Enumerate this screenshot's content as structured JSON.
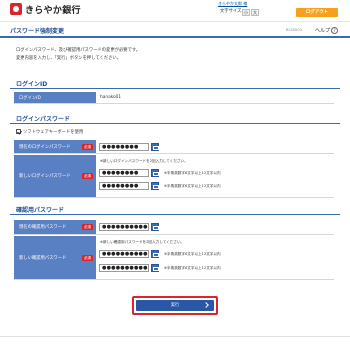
{
  "header": {
    "brand": "きらやか銀行",
    "user_name": "きらやか太郎 様",
    "user_suffix": "前回ログイン日時 2015年10月01日 10時00分00秒",
    "font_size_label": "文字サイズ",
    "font_small": "小",
    "font_large": "大",
    "logout": "ログアウト"
  },
  "page": {
    "title": "パスワード強制変更",
    "screen_id": "BLS0003",
    "help": "ヘルプ",
    "help_icon": "?"
  },
  "intro": {
    "line1": "ログインパスワード、及び確認用パスワードの変更が必要です。",
    "line2": "変更内容を入力し、「実行」ボタンを押してください。"
  },
  "login_id": {
    "section": "ログインID",
    "label": "ログインID",
    "value": "hanako01"
  },
  "login_password": {
    "section": "ログインパスワード",
    "software_keyboard": "ソフトウェアキーボードを使用",
    "current_label": "現在のログインパスワード",
    "current_value": "●●●●●●●●",
    "new_label": "新しいログインパスワード",
    "new_note": "※新しいログインパスワードを2回入力してください。",
    "new_value1": "●●●●●●●●",
    "new_value2": "●●●●●●●●",
    "hint": "※半角英数字6文字以上12文字以内"
  },
  "confirm_password": {
    "section": "確認用パスワード",
    "current_label": "現在の確認用パスワード",
    "current_value": "●●●●●●●●●●",
    "new_label": "新しい確認用パスワード",
    "new_note": "※新しい確認用パスワードを2回入力してください。",
    "new_value1": "●●●●●●●●●●",
    "new_value2": "●●●●●●●●●●",
    "hint": "※半角英数字6文字以上12文字以内"
  },
  "required_badge": "必須",
  "submit": "実行",
  "colors": {
    "brand_red": "#d9262d",
    "accent_blue": "#1f4d96",
    "label_blue": "#5a80c4",
    "logout_orange": "#f5a11c",
    "button_blue": "#2a56a6"
  }
}
